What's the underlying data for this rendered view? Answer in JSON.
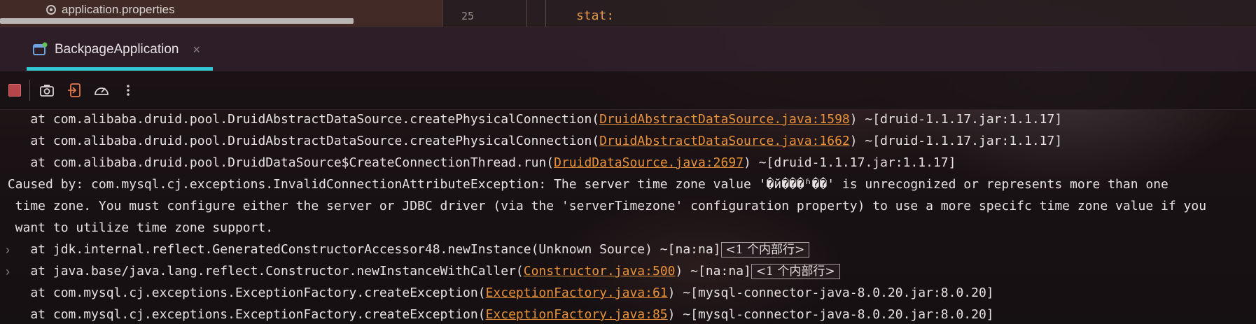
{
  "editor": {
    "project_file": "application.properties",
    "line_number": "25",
    "code_text": "stat:"
  },
  "run_tab": {
    "label": "BackpageApplication",
    "close": "×",
    "accent": "#35c6d4"
  },
  "console": {
    "link_color": "#e8913b",
    "lines": [
      {
        "pre": "    at com.alibaba.druid.pool.DruidAbstractDataSource.createPhysicalConnection(",
        "link": "DruidAbstractDataSource.java:1598",
        "post": ") ~[druid-1.1.17.jar:1.1.17]"
      },
      {
        "pre": "    at com.alibaba.druid.pool.DruidAbstractDataSource.createPhysicalConnection(",
        "link": "DruidAbstractDataSource.java:1662",
        "post": ") ~[druid-1.1.17.jar:1.1.17]"
      },
      {
        "pre": "    at com.alibaba.druid.pool.DruidDataSource$CreateConnectionThread.run(",
        "link": "DruidDataSource.java:2697",
        "post": ") ~[druid-1.1.17.jar:1.1.17]"
      },
      {
        "pre": " Caused by: com.mysql.cj.exceptions.InvalidConnectionAttributeException: The server time zone value '�й���ʱ��' is unrecognized or represents more than one",
        "link": "",
        "post": ""
      },
      {
        "pre": "  time zone. You must configure either the server or JDBC driver (via the 'serverTimezone' configuration property) to use a more specifc time zone value if you",
        "link": "",
        "post": ""
      },
      {
        "pre": "  want to utilize time zone support.",
        "link": "",
        "post": ""
      },
      {
        "pre": "    at jdk.internal.reflect.GeneratedConstructorAccessor48.newInstance(Unknown Source) ~[na:na]",
        "link": "",
        "post": "",
        "fold": "<1 个内部行>"
      },
      {
        "pre": "    at java.base/java.lang.reflect.Constructor.newInstanceWithCaller(",
        "link": "Constructor.java:500",
        "post": ") ~[na:na]",
        "fold": "<1 个内部行>"
      },
      {
        "pre": "    at com.mysql.cj.exceptions.ExceptionFactory.createException(",
        "link": "ExceptionFactory.java:61",
        "post": ") ~[mysql-connector-java-8.0.20.jar:8.0.20]"
      },
      {
        "pre": "    at com.mysql.cj.exceptions.ExceptionFactory.createException(",
        "link": "ExceptionFactory.java:85",
        "post": ") ~[mysql-connector-java-8.0.20.jar:8.0.20]"
      }
    ]
  }
}
